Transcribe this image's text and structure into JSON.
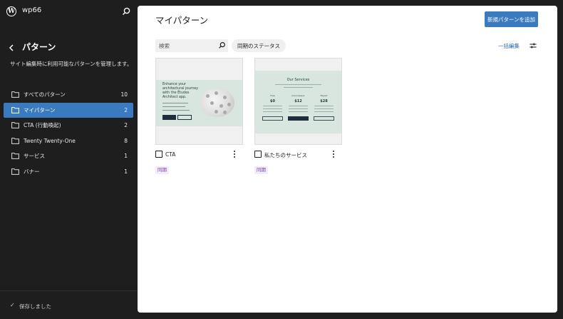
{
  "site": {
    "name": "wp66"
  },
  "sidebar": {
    "title": "パターン",
    "description": "サイト編集時に利用可能なパターンを管理します。",
    "categories": [
      {
        "label": "すべてのパターン",
        "count": "10"
      },
      {
        "label": "マイパターン",
        "count": "2"
      },
      {
        "label": "CTA (行動喚起)",
        "count": "2"
      },
      {
        "label": "Twenty Twenty-One",
        "count": "8"
      },
      {
        "label": "サービス",
        "count": "1"
      },
      {
        "label": "バナー",
        "count": "1"
      }
    ],
    "active_index": 1,
    "footer_status": "保存しました"
  },
  "main": {
    "title": "マイパターン",
    "add_button": "新規パターンを追加",
    "search_placeholder": "検索",
    "filter_label": "同期のステータス",
    "bulk_edit": "一括編集",
    "cards": [
      {
        "title": "CTA",
        "badge": "同期",
        "preview": {
          "heading": "Enhance your architectural journey with the Études Architect app."
        }
      },
      {
        "title": "私たちのサービス",
        "badge": "同期",
        "preview": {
          "heading": "Our Services",
          "columns": [
            {
              "name": "Free",
              "price": "$0"
            },
            {
              "name": "Connoisseur",
              "price": "$12"
            },
            {
              "name": "Expert",
              "price": "$28"
            }
          ]
        }
      }
    ]
  },
  "colors": {
    "sidebar_bg": "#1e1e1e",
    "accent": "#3a7bc0",
    "preview_band": "#d9e6e0",
    "sync_badge": "#7a3fb5"
  },
  "icons": {
    "logo": "wordpress-logo-icon",
    "search": "search-icon",
    "back": "chevron-left-icon",
    "folder": "folder-icon",
    "check": "check-icon",
    "more": "more-vertical-icon",
    "view_options": "sliders-icon"
  }
}
